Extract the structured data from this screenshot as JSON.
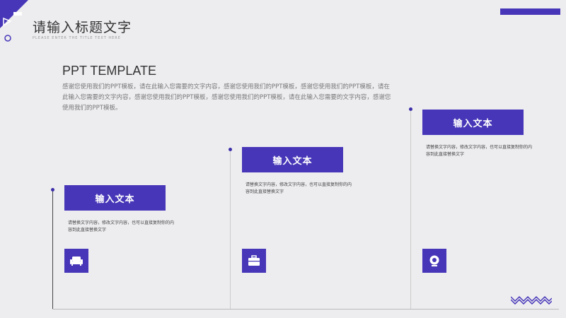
{
  "header": {
    "title": "请输入标题文字",
    "subtitle": "PLEASE ENTER THE TITLE TEXT HERE"
  },
  "template": {
    "heading": "PPT TEMPLATE",
    "paragraph": "感谢您使用我们的PPT模板，请在此输入您需要的文字内容，感谢您使用我们的PPT模板，感谢您使用我们的PPT模板，请在此输入您需要的文字内容，感谢您使用我们的PPT模板，感谢您使用我们的PPT模板，请在此输入您需要的文字内容，感谢您使用我们的PPT模板。"
  },
  "cards": [
    {
      "label": "输入文本",
      "description": "请替换文字内容，修改文字内容，也可以直接复制你的内容到此直接替换文字",
      "icon": "sofa-icon"
    },
    {
      "label": "输入文本",
      "description": "请替换文字内容，修改文字内容，也可以直接复制你的内容到此直接替换文字",
      "icon": "briefcase-icon"
    },
    {
      "label": "输入文本",
      "description": "请替换文字内容，修改文字内容，也可以直接复制你的内容到此直接替换文字",
      "icon": "webcam-icon"
    }
  ],
  "colors": {
    "accent": "#4737b8",
    "background": "#ededf0"
  }
}
